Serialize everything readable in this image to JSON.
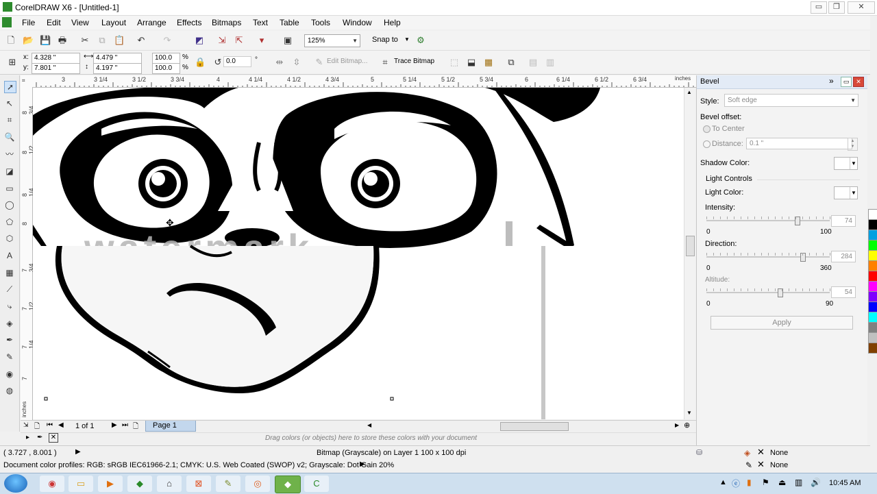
{
  "window": {
    "title": "CorelDRAW X6 - [Untitled-1]",
    "min_label": "▭",
    "restore_label": "❐",
    "close_label": "✕"
  },
  "menu": [
    "File",
    "Edit",
    "View",
    "Layout",
    "Arrange",
    "Effects",
    "Bitmaps",
    "Text",
    "Table",
    "Tools",
    "Window",
    "Help"
  ],
  "toolbar": {
    "zoom": "125%",
    "snap_to": "Snap to"
  },
  "propbar": {
    "x_label": "x:",
    "x_value": "4.328 \"",
    "y_label": "y:",
    "y_value": "7.801 \"",
    "w_value": "4.479 \"",
    "h_value": "4.197 \"",
    "scale_w": "100.0",
    "scale_h": "100.0",
    "percent": "%",
    "rotation": "0.0",
    "degree": "°",
    "edit_bitmap": "Edit Bitmap...",
    "trace_bitmap": "Trace Bitmap"
  },
  "ruler": {
    "h_ticks": [
      "3",
      "3 1/4",
      "3 1/2",
      "3 3/4",
      "4",
      "4 1/4",
      "4 1/2",
      "4 3/4",
      "5",
      "5 1/4",
      "5 1/2",
      "5 3/4",
      "6",
      "6 1/4",
      "6 1/2",
      "6 3/4"
    ],
    "units": "inches",
    "v_ticks": [
      "8 3/4",
      "8 1/2",
      "8 1/4",
      "8",
      "7 3/4",
      "7 1/2",
      "7 1/4",
      "7"
    ],
    "v_units": "inches"
  },
  "canvas": {
    "watermark": "watermark"
  },
  "pagenav": {
    "page_count": "1 of 1",
    "page_tab": "Page 1"
  },
  "docpalette": {
    "hint": "Drag colors (or objects) here to store these colors with your document"
  },
  "status": {
    "coords": "( 3.727 , 8.001 )",
    "selection_info": "Bitmap (Grayscale) on Layer 1 100 x 100 dpi",
    "fill_label": "None",
    "outline_label": "None",
    "color_profiles": "Document color profiles: RGB: sRGB IEC61966-2.1; CMYK: U.S. Web Coated (SWOP) v2; Grayscale: Dot Gain 20%"
  },
  "docker": {
    "title": "Bevel",
    "style_label": "Style:",
    "style_value": "Soft edge",
    "bevel_offset_label": "Bevel offset:",
    "to_center": "To Center",
    "distance_label": "Distance:",
    "distance_value": "0.1 \"",
    "shadow_color_label": "Shadow Color:",
    "light_controls_label": "Light Controls",
    "light_color_label": "Light Color:",
    "intensity_label": "Intensity:",
    "intensity_min": "0",
    "intensity_max": "100",
    "intensity_value": 74,
    "direction_label": "Direction:",
    "direction_min": "0",
    "direction_max": "360",
    "direction_value": 284,
    "altitude_label": "Altitude:",
    "altitude_min": "0",
    "altitude_max": "90",
    "altitude_value": 54,
    "apply_label": "Apply"
  },
  "palette_colors": [
    "#ffffff",
    "#000000",
    "#00a0e0",
    "#00ff00",
    "#ffff00",
    "#ff8000",
    "#ff0000",
    "#ff00ff",
    "#8000ff",
    "#0000ff",
    "#00ffff",
    "#808080",
    "#c0c0c0",
    "#804000"
  ],
  "taskbar": {
    "time": "10:45 AM"
  }
}
